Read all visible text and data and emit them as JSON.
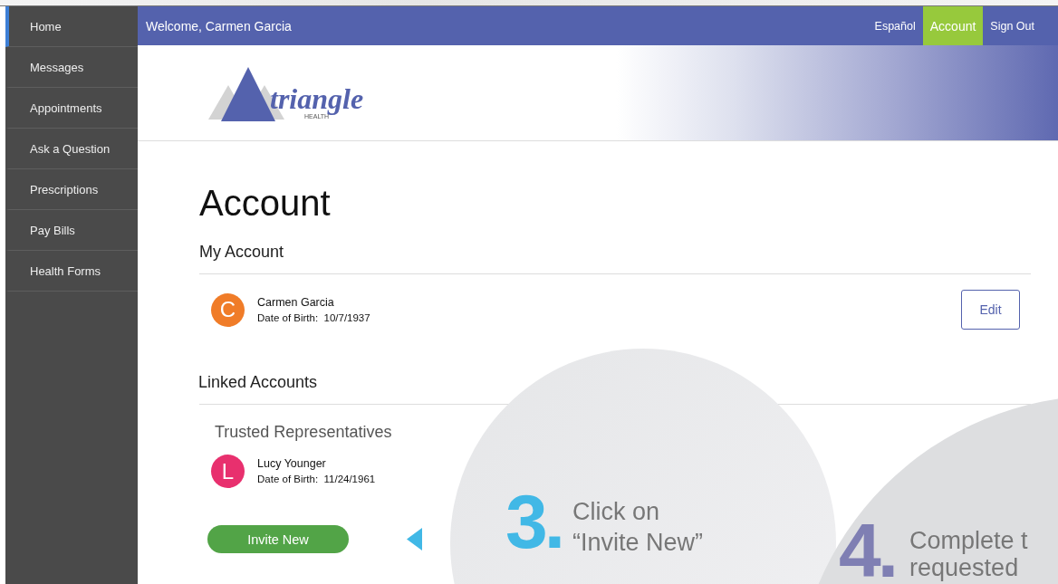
{
  "sidebar": {
    "items": [
      {
        "label": "Home",
        "selected": true
      },
      {
        "label": "Messages",
        "selected": false
      },
      {
        "label": "Appointments",
        "selected": false
      },
      {
        "label": "Ask a Question",
        "selected": false
      },
      {
        "label": "Prescriptions",
        "selected": false
      },
      {
        "label": "Pay Bills",
        "selected": false
      },
      {
        "label": "Health Forms",
        "selected": false
      }
    ]
  },
  "top_bar": {
    "welcome": "Welcome, Carmen Garcia",
    "links": [
      {
        "label": "Español",
        "selected": false
      },
      {
        "label": "Account",
        "selected": true
      },
      {
        "label": "Sign Out",
        "selected": false
      }
    ]
  },
  "logo": {
    "name": "triangle",
    "subtitle": "HEALTH"
  },
  "page_title": "Account",
  "my_account": {
    "heading": "My Account",
    "person": {
      "initial": "C",
      "color": "#f07c28",
      "name": "Carmen Garcia",
      "dob_label": "Date of Birth:",
      "dob": "10/7/1937"
    },
    "edit_button": "Edit"
  },
  "linked_accounts": {
    "heading": "Linked Accounts",
    "subheading": "Trusted Representatives",
    "people": [
      {
        "initial": "L",
        "color": "#e8306e",
        "name": "Lucy Younger",
        "dob_label": "Date of Birth:",
        "dob": "11/24/1961"
      }
    ],
    "invite_button": "Invite New"
  },
  "callouts": [
    {
      "number": "3.",
      "color": "#41b8e6",
      "lines": [
        "Click on",
        "“Invite New”"
      ]
    },
    {
      "number": "4.",
      "color": "#7f7fb3",
      "lines": [
        "Complete t",
        "requested"
      ]
    }
  ]
}
